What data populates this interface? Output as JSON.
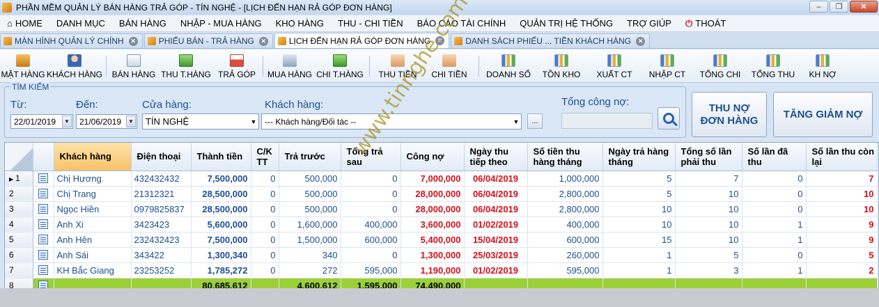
{
  "window": {
    "title": "PHẦN MỀM QUẢN LÝ BÁN HÀNG TRẢ GÓP - TÍN NGHỆ - [LỊCH ĐẾN HẠN RẢ GÓP ĐƠN HÀNG]",
    "minimize": "–",
    "restore": "❐",
    "close": "✕"
  },
  "menu": [
    {
      "label": "HOME",
      "icon": "home-icon"
    },
    {
      "label": "DANH MỤC"
    },
    {
      "label": "BÁN HÀNG"
    },
    {
      "label": "NHẬP - MUA HÀNG"
    },
    {
      "label": "KHO HÀNG"
    },
    {
      "label": "THU - CHI TIỀN"
    },
    {
      "label": "BÁO CÁO TÀI CHÍNH"
    },
    {
      "label": "QUẢN TRỊ HỆ THỐNG"
    },
    {
      "label": "TRỢ GIÚP"
    },
    {
      "label": "THOÁT",
      "icon": "power-icon"
    }
  ],
  "tabs": [
    {
      "label": "MÀN HÌNH QUẢN LÝ CHÍNH",
      "active": false
    },
    {
      "label": "PHIẾU BÁN - TRẢ HÀNG",
      "active": false
    },
    {
      "label": "LỊCH ĐẾN HẠN RẢ GÓP ĐƠN HÀNG",
      "active": true
    },
    {
      "label": "DANH SÁCH PHIẾU ... TIỀN KHÁCH HÀNG",
      "active": false
    }
  ],
  "toolbar": [
    {
      "label": "MẶT HÀNG",
      "icon": "box-icon"
    },
    {
      "label": "KHÁCH HÀNG",
      "icon": "customer-icon"
    },
    {
      "label": "BÁN HÀNG",
      "icon": "sales-doc-icon"
    },
    {
      "label": "THU T.HÀNG",
      "icon": "money-in-icon"
    },
    {
      "label": "TRẢ GÓP",
      "icon": "calendar-icon"
    },
    {
      "label": "MUA HÀNG",
      "icon": "cart-icon"
    },
    {
      "label": "CHI T.HÀNG",
      "icon": "money-out-icon"
    },
    {
      "label": "THU TIỀN",
      "icon": "hand-in-icon"
    },
    {
      "label": "CHI TIỀN",
      "icon": "hand-out-icon"
    },
    {
      "label": "DOANH SỐ",
      "icon": "chart-icon"
    },
    {
      "label": "TỒN KHO",
      "icon": "chart-icon"
    },
    {
      "label": "XUẤT CT",
      "icon": "chart-icon"
    },
    {
      "label": "NHẬP CT",
      "icon": "chart-icon"
    },
    {
      "label": "TỔNG CHI",
      "icon": "chart-icon"
    },
    {
      "label": "TỔNG THU",
      "icon": "chart-icon"
    },
    {
      "label": "KH NỢ",
      "icon": "chart-icon"
    }
  ],
  "search": {
    "legend": "TÌM KIẾM",
    "from_label": "Từ:",
    "from_value": "22/01/2019",
    "to_label": "Đến:",
    "to_value": "21/06/2019",
    "store_label": "Cửa hàng:",
    "store_value": "TÍN NGHỆ",
    "customer_label": "Khách hàng:",
    "customer_value": "--- Khách hàng/Đối tác --",
    "more_button": "...",
    "debt_label": "Tổng công nợ:",
    "debt_value": ""
  },
  "buttons": {
    "thu_no": "THU NỢ ĐƠN HÀNG",
    "tang_giam": "TĂNG GIẢM NỢ"
  },
  "grid": {
    "columns": [
      "Khách hàng",
      "Điện thoại",
      "Thành tiền",
      "C/K TT",
      "Trả trước",
      "Tổng trả sau",
      "Công nợ",
      "Ngày thu tiếp theo",
      "Số tiền thu hàng tháng",
      "Ngày trả hàng tháng",
      "Tổng số lần phải thu",
      "Số lần đã thu",
      "Số lần thu còn lại"
    ],
    "rows": [
      [
        "Chị Hương",
        "432432432",
        "7,500,000",
        "0",
        "500,000",
        "0",
        "7,000,000",
        "06/04/2019",
        "1,000,000",
        "5",
        "7",
        "0",
        "7"
      ],
      [
        "Chị Trang",
        "21312321",
        "28,500,000",
        "0",
        "500,000",
        "0",
        "28,000,000",
        "06/04/2019",
        "2,800,000",
        "5",
        "10",
        "0",
        "10"
      ],
      [
        "Ngọc Hiền",
        "0979825837",
        "28,500,000",
        "0",
        "500,000",
        "0",
        "28,000,000",
        "06/04/2019",
        "2,800,000",
        "10",
        "10",
        "0",
        "10"
      ],
      [
        "Anh Xi",
        "3423423",
        "5,600,000",
        "0",
        "1,600,000",
        "400,000",
        "3,600,000",
        "01/02/2019",
        "400,000",
        "10",
        "10",
        "1",
        "9"
      ],
      [
        "Anh Hên",
        "232432423",
        "7,500,000",
        "0",
        "1,500,000",
        "600,000",
        "5,400,000",
        "15/04/2019",
        "600,000",
        "15",
        "10",
        "1",
        "9"
      ],
      [
        "Anh Sái",
        "343422",
        "1,300,340",
        "0",
        "340",
        "0",
        "1,300,000",
        "25/03/2019",
        "260,000",
        "1",
        "5",
        "0",
        "5"
      ],
      [
        "KH Bắc Giang",
        "23253252",
        "1,785,272",
        "0",
        "272",
        "595,000",
        "1,190,000",
        "01/02/2019",
        "595,000",
        "1",
        "3",
        "1",
        "2"
      ]
    ],
    "row_numbers": [
      "1",
      "2",
      "3",
      "4",
      "5",
      "6",
      "7",
      "8"
    ],
    "totals": {
      "thanh_tien": "80,685,612",
      "tra_truoc": "4,600,612",
      "tong_tra_sau": "1,595,000",
      "cong_no": "74,490,000"
    }
  },
  "watermark": "www.tinnghe.com",
  "colors": {
    "accent_blue": "#1d4f91",
    "debt_red": "#d4101a",
    "total_row": "#9bd036"
  }
}
